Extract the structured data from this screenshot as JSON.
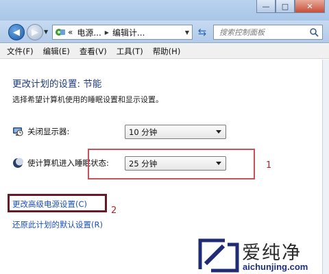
{
  "window": {
    "minimize_glyph": "—",
    "maximize_glyph": "□",
    "close_glyph": "✕"
  },
  "navbar": {
    "breadcrumb": [
      "电源...",
      "编辑计..."
    ],
    "breadcrumb_prefix": "«",
    "search_placeholder": "搜索控制面板"
  },
  "menubar": {
    "items": [
      "文件(F)",
      "编辑(E)",
      "查看(V)",
      "工具(T)",
      "帮助(H)"
    ]
  },
  "main": {
    "title": "更改计划的设置: 节能",
    "description": "选择希望计算机使用的睡眠设置和显示设置。",
    "display_off": {
      "label": "关闭显示器:",
      "value": "10 分钟"
    },
    "sleep": {
      "label": "使计算机进入睡眠状态:",
      "value": "25 分钟"
    },
    "links": {
      "advanced": "更改高级电源设置(C)",
      "restore": "还原此计划的默认设置(R)"
    }
  },
  "annotations": {
    "label_1": "1",
    "label_2": "2"
  },
  "watermark": {
    "brand": "爱纯净",
    "url": "aichunjing.com"
  },
  "colors": {
    "link": "#1a50b8",
    "title": "#1f3b7a",
    "annotation_red": "#c9515b",
    "annotation_dark": "#6c1626"
  }
}
